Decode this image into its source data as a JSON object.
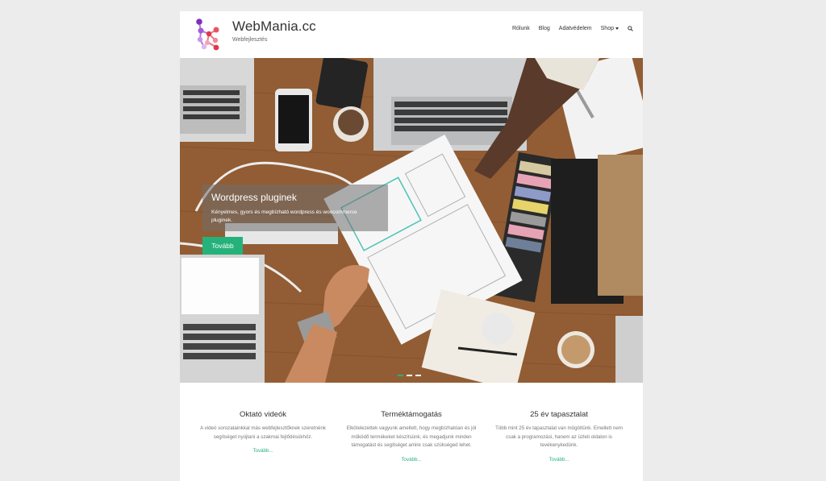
{
  "header": {
    "site_title": "WebMania.cc",
    "tagline": "Webfejlesztés",
    "nav": [
      {
        "label": "Rólunk"
      },
      {
        "label": "Blog"
      },
      {
        "label": "Adatvédelem"
      },
      {
        "label": "Shop"
      }
    ],
    "search_icon": "search-icon"
  },
  "hero": {
    "title": "Wordpress pluginek",
    "text": "Kényelmes, gyors és megbízható wordpress és woocommerce pluginek.",
    "button": "Tovább",
    "slides": 3,
    "active_slide": 1
  },
  "features": [
    {
      "title": "Oktató videók",
      "text": "A videó sorozatainkkal más webfejlesztőknek szeretnénk segítséget nyújtani a szakmai fejlődésükhöz.",
      "link": "Tovább..."
    },
    {
      "title": "Terméktámogatás",
      "text": "Elkötelezettek vagyunk amellett, hogy megbízhatóan és jól működő termékeket készítsünk, és megadjunk minden támogatást és segítséget amire csak szükséged lehet.",
      "link": "Tovább..."
    },
    {
      "title": "25 év tapasztalat",
      "text": "Több mint 25 év tapasztalat van mögöttünk. Emellett nem csak a programozási, hanem az üzleti oldalon is tevékenykedünk.",
      "link": "Tovább..."
    }
  ],
  "colors": {
    "accent": "#25b27a",
    "page_bg": "#ececec",
    "logo_purple": "#8e3fc2",
    "logo_red": "#e0374a"
  }
}
